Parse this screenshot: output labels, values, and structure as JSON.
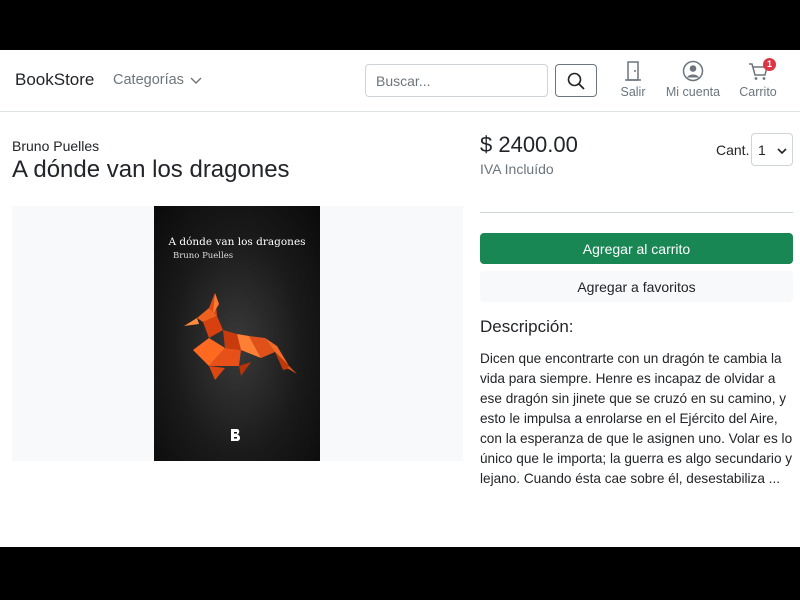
{
  "navbar": {
    "brand": "BookStore",
    "categories_label": "Categorías",
    "search_placeholder": "Buscar...",
    "logout_label": "Salir",
    "account_label": "Mi cuenta",
    "cart_label": "Carrito",
    "cart_count": "1"
  },
  "product": {
    "author": "Bruno Puelles",
    "title": "A dónde van los dragones",
    "price": "$ 2400.00",
    "tax_note": "IVA Incluído",
    "quantity_label": "Cant.",
    "quantity_value": "1",
    "add_to_cart_label": "Agregar al carrito",
    "add_to_favorites_label": "Agregar a favoritos",
    "description_heading": "Descripción:",
    "description": "Dicen que encontrarte con un dragón te cambia la vida para siempre. Henre es incapaz de olvidar a ese dragón sin jinete que se cruzó en su camino, y esto le impulsa a enrolarse en el Ejército del Aire, con la esperanza de que le asignen uno. Volar es lo único que le importa; la guerra es algo secundario y lejano. Cuando ésta cae sobre él, desestabiliza ...",
    "cover": {
      "title": "A dónde van los dragones",
      "author": "Bruno Puelles",
      "illustration": "origami-dragon",
      "publisher_logo": "publisher-b-logo"
    }
  },
  "colors": {
    "accent_green": "#198754",
    "badge_red": "#dc3545",
    "dragon_orange": "#f05a1e"
  }
}
